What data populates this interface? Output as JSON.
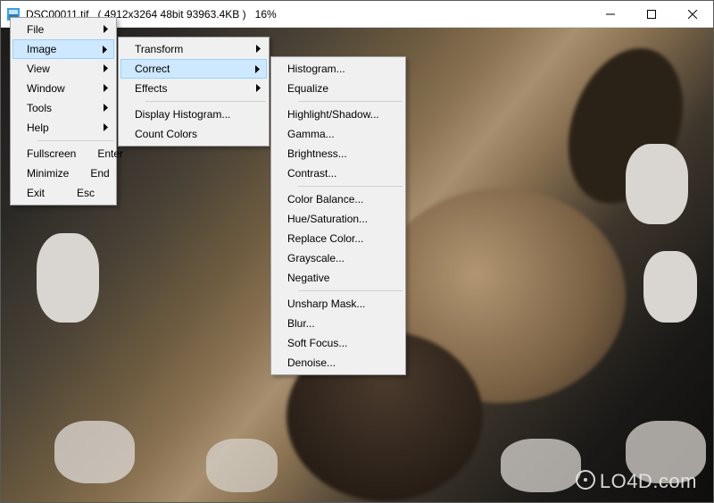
{
  "titlebar": {
    "filename": "DSC00011.tif",
    "dims_bits_size": "(  4912x3264  48bit  93963.4KB )",
    "zoom": "16%"
  },
  "menu_main": {
    "items": [
      {
        "label": "File",
        "has_submenu": true
      },
      {
        "label": "Image",
        "has_submenu": true,
        "highlighted": true
      },
      {
        "label": "View",
        "has_submenu": true
      },
      {
        "label": "Window",
        "has_submenu": true
      },
      {
        "label": "Tools",
        "has_submenu": true
      },
      {
        "label": "Help",
        "has_submenu": true
      }
    ],
    "footer": [
      {
        "label": "Fullscreen",
        "shortcut": "Enter"
      },
      {
        "label": "Minimize",
        "shortcut": "End"
      },
      {
        "label": "Exit",
        "shortcut": "Esc"
      }
    ]
  },
  "menu_image": {
    "items": [
      {
        "label": "Transform",
        "has_submenu": true
      },
      {
        "label": "Correct",
        "has_submenu": true,
        "highlighted": true
      },
      {
        "label": "Effects",
        "has_submenu": true
      }
    ],
    "footer": [
      {
        "label": "Display Histogram..."
      },
      {
        "label": "Count Colors"
      }
    ]
  },
  "menu_correct": {
    "groups": [
      [
        "Histogram...",
        "Equalize"
      ],
      [
        "Highlight/Shadow...",
        "Gamma...",
        "Brightness...",
        "Contrast..."
      ],
      [
        "Color Balance...",
        "Hue/Saturation...",
        "Replace Color...",
        "Grayscale...",
        "Negative"
      ],
      [
        "Unsharp Mask...",
        "Blur...",
        "Soft Focus...",
        "Denoise..."
      ]
    ]
  },
  "watermark": "LO4D.com"
}
